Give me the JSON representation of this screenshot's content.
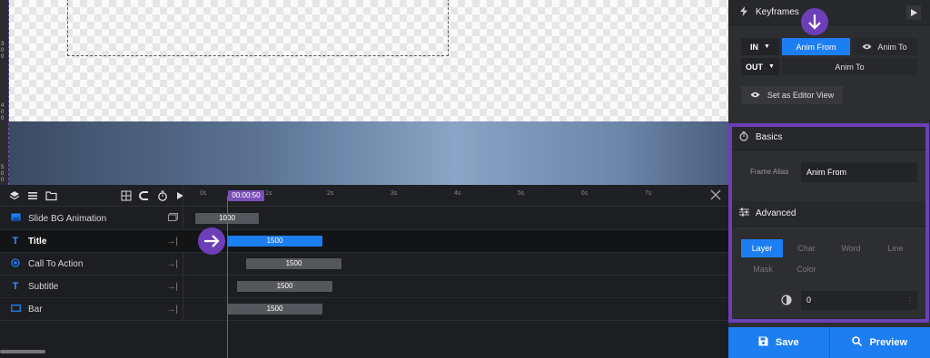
{
  "canvas": {
    "ruler_numbers": [
      "3",
      "0",
      "0",
      "4",
      "0",
      "0",
      "5",
      "0",
      "0"
    ]
  },
  "timeline": {
    "current_time": "00:00:50",
    "ticks": [
      "0s",
      "1s",
      "2s",
      "3s",
      "4s",
      "5s",
      "6s",
      "7s"
    ],
    "layers": [
      {
        "name": "Slide BG Animation",
        "icon": "image-icon",
        "duration": "1000"
      },
      {
        "name": "Title",
        "icon": "text-icon",
        "duration": "1500",
        "selected": true
      },
      {
        "name": "Call To Action",
        "icon": "target-icon",
        "duration": "1500"
      },
      {
        "name": "Subtitle",
        "icon": "text-icon",
        "duration": "1500"
      },
      {
        "name": "Bar",
        "icon": "rectangle-icon",
        "duration": "1500"
      }
    ]
  },
  "panel": {
    "keyframes_title": "Keyframes",
    "in_label": "IN",
    "out_label": "OUT",
    "anim_from": "Anim From",
    "anim_to": "Anim To",
    "anim_to_out": "Anim To",
    "set_editor_view": "Set as Editor View",
    "basics_title": "Basics",
    "frame_alias_label": "Frame Alias",
    "frame_alias_value": "Anim From",
    "advanced_title": "Advanced",
    "tabs_row1": [
      "Layer",
      "Char",
      "Word",
      "Line"
    ],
    "tabs_row2": [
      "Mask",
      "Color"
    ],
    "opacity_value": "0",
    "save_label": "Save",
    "preview_label": "Preview"
  },
  "colors": {
    "accent_blue": "#1d7ef2",
    "highlight_purple": "#6c3fb8"
  }
}
